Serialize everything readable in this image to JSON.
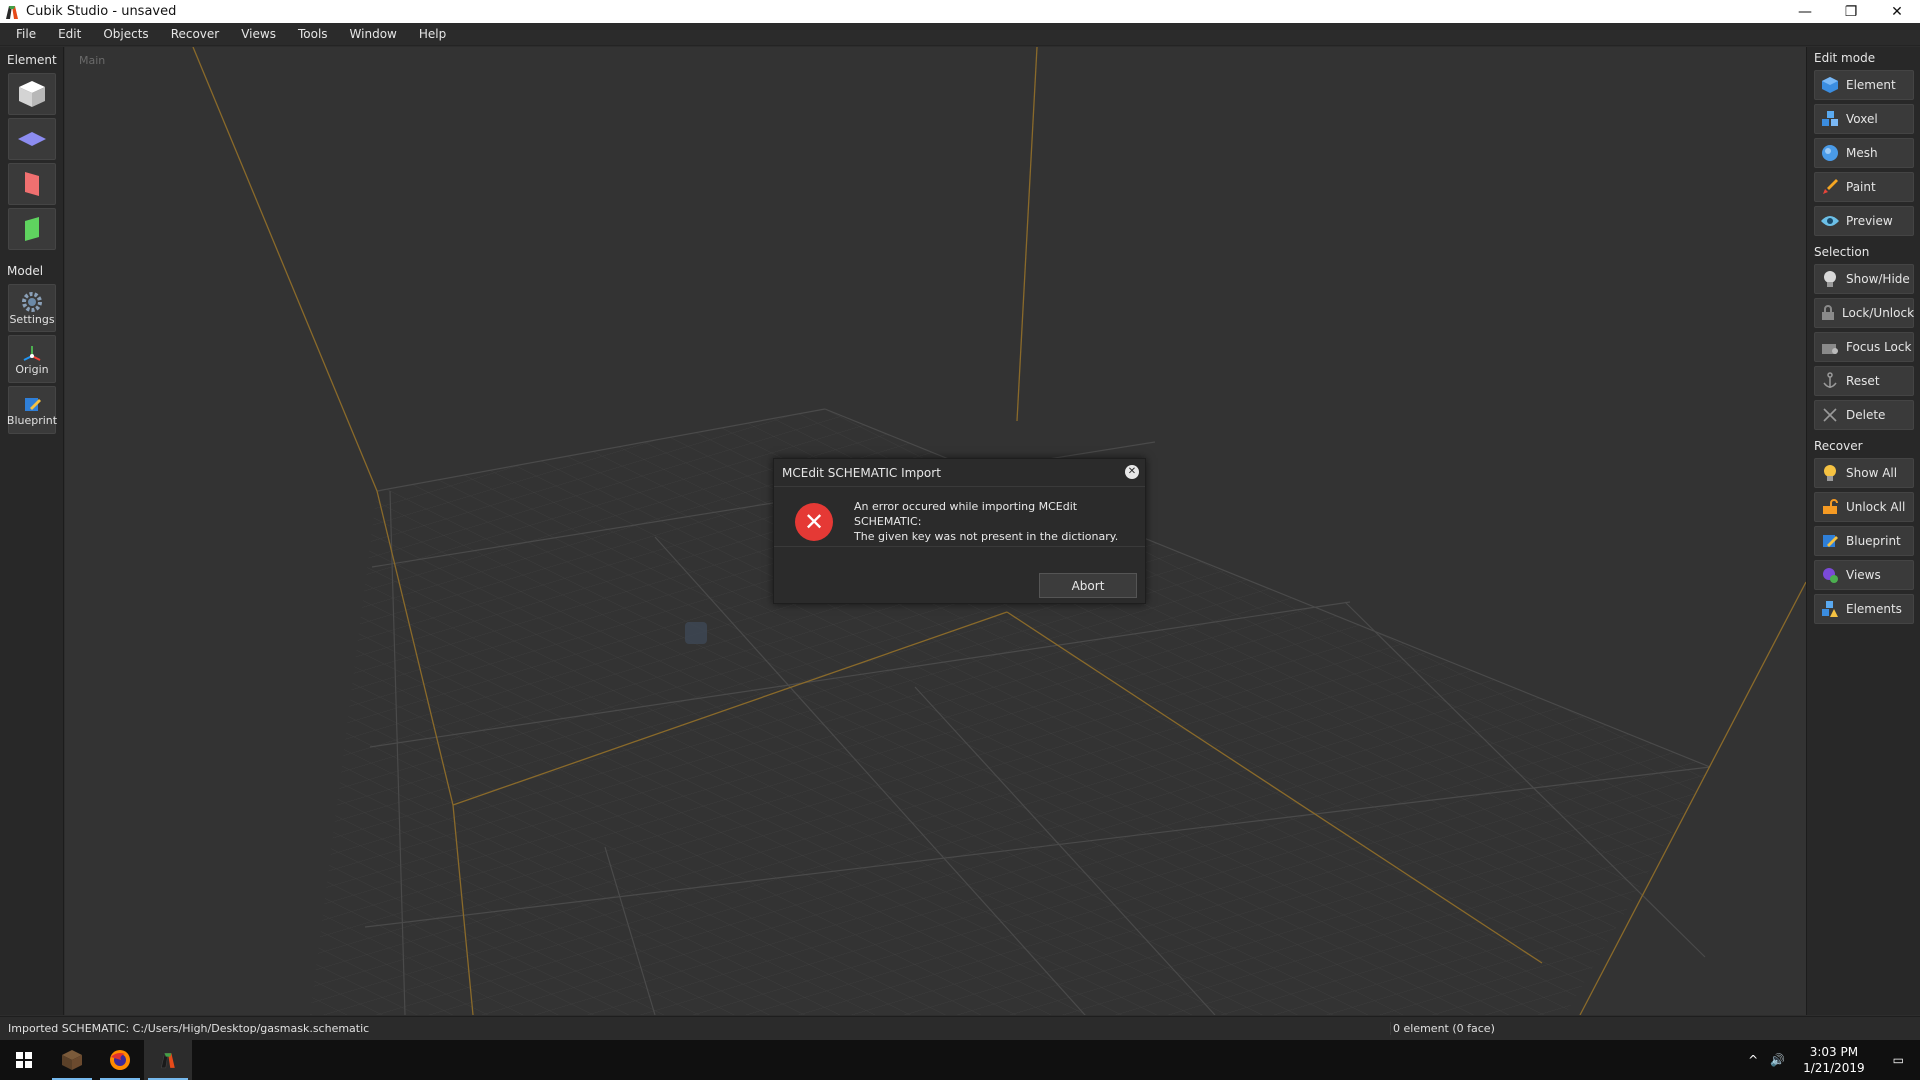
{
  "window": {
    "title": "Cubik Studio - unsaved",
    "controls": {
      "minimize": "—",
      "restore": "❐",
      "close": "✕"
    }
  },
  "menubar": {
    "items": [
      "File",
      "Edit",
      "Objects",
      "Recover",
      "Views",
      "Tools",
      "Window",
      "Help"
    ]
  },
  "left_panel": {
    "element_label": "Element",
    "model_label": "Model",
    "element_tools": [
      {
        "icon": "cube-icon"
      },
      {
        "icon": "plane-icon"
      },
      {
        "icon": "red-face-icon"
      },
      {
        "icon": "green-face-icon"
      }
    ],
    "model_tools": [
      {
        "label": "Settings",
        "icon": "gear-icon"
      },
      {
        "label": "Origin",
        "icon": "origin-axes-icon"
      },
      {
        "label": "Blueprint",
        "icon": "blueprint-icon"
      }
    ]
  },
  "viewport": {
    "label": "Main"
  },
  "right_panel": {
    "edit_mode": {
      "title": "Edit mode",
      "items": [
        {
          "label": "Element",
          "icon": "element-cube-icon",
          "color": "#3b8de0"
        },
        {
          "label": "Voxel",
          "icon": "voxel-icon",
          "color": "#4a9be8"
        },
        {
          "label": "Mesh",
          "icon": "sphere-icon",
          "color": "#5aa9f0"
        },
        {
          "label": "Paint",
          "icon": "brush-icon",
          "color": "#e86a3a"
        },
        {
          "label": "Preview",
          "icon": "eye-icon",
          "color": "#6cc0e8"
        }
      ]
    },
    "selection": {
      "title": "Selection",
      "items": [
        {
          "label": "Show/Hide",
          "icon": "bulb-icon"
        },
        {
          "label": "Lock/Unlock",
          "icon": "lock-icon"
        },
        {
          "label": "Focus Lock",
          "icon": "focus-lock-icon"
        },
        {
          "label": "Reset",
          "icon": "anchor-icon"
        },
        {
          "label": "Delete",
          "icon": "delete-x-icon"
        }
      ]
    },
    "recover": {
      "title": "Recover",
      "items": [
        {
          "label": "Show All",
          "icon": "bulb-on-icon"
        },
        {
          "label": "Unlock All",
          "icon": "unlock-icon"
        },
        {
          "label": "Blueprint",
          "icon": "blueprint-pencil-icon"
        },
        {
          "label": "Views",
          "icon": "views-icon"
        },
        {
          "label": "Elements",
          "icon": "elements-warning-icon"
        }
      ]
    }
  },
  "dialog": {
    "title": "MCEdit SCHEMATIC Import",
    "message_line1": "An error occured while importing MCEdit SCHEMATIC:",
    "message_line2": "The given key was not present in the dictionary.",
    "abort_label": "Abort",
    "close_glyph": "✕",
    "error_glyph": "✕"
  },
  "statusbar": {
    "left": "Imported SCHEMATIC: C:/Users/High/Desktop/gasmask.schematic",
    "right": "0 element (0 face)"
  },
  "taskbar": {
    "apps": [
      "windows-start-icon",
      "minecraft-icon",
      "firefox-icon",
      "cubik-studio-icon"
    ],
    "time": "3:03 PM",
    "date": "1/21/2019"
  }
}
